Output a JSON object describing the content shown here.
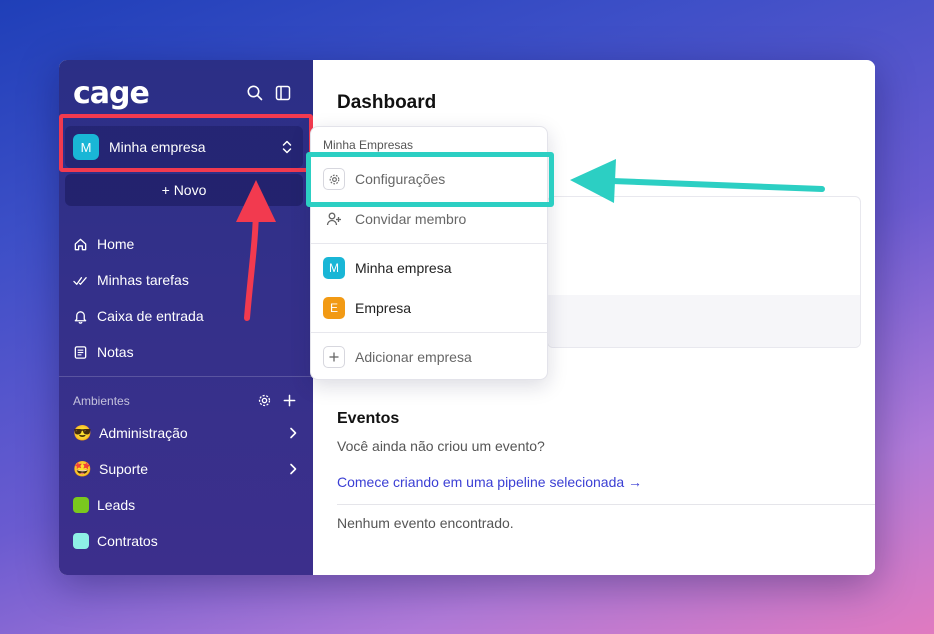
{
  "app": {
    "logo": "cage"
  },
  "sidebar": {
    "company": {
      "initial": "M",
      "name": "Minha empresa"
    },
    "new_label": "+ Novo",
    "nav": [
      {
        "label": "Home",
        "icon": "home-icon"
      },
      {
        "label": "Minhas tarefas",
        "icon": "checks-icon"
      },
      {
        "label": "Caixa de entrada",
        "icon": "bell-icon"
      },
      {
        "label": "Notas",
        "icon": "notes-icon"
      }
    ],
    "section_label": "Ambientes",
    "environments": [
      {
        "label": "Administração",
        "emoji": "😎",
        "has_chevron": true
      },
      {
        "label": "Suporte",
        "emoji": "🤩",
        "has_chevron": true
      },
      {
        "label": "Leads",
        "color": "#7ac81e"
      },
      {
        "label": "Contratos",
        "color": "#8ef0e6"
      }
    ]
  },
  "main": {
    "title": "Dashboard",
    "events": {
      "title": "Eventos",
      "empty_text": "Você ainda não criou um evento?",
      "link": "Comece criando em uma pipeline selecionada →",
      "none_text": "Nenhum evento encontrado."
    }
  },
  "dropdown": {
    "header": "Minha Empresas",
    "settings_label": "Configurações",
    "invite_label": "Convidar membro",
    "companies": [
      {
        "initial": "M",
        "name": "Minha empresa",
        "color": "#19b6d6"
      },
      {
        "initial": "E",
        "name": "Empresa",
        "color": "#f29a14"
      }
    ],
    "add_label": "Adicionar empresa"
  },
  "colors": {
    "highlight_red": "#f23a4f",
    "highlight_teal": "#2ccfc3",
    "link": "#3b3fd4"
  }
}
